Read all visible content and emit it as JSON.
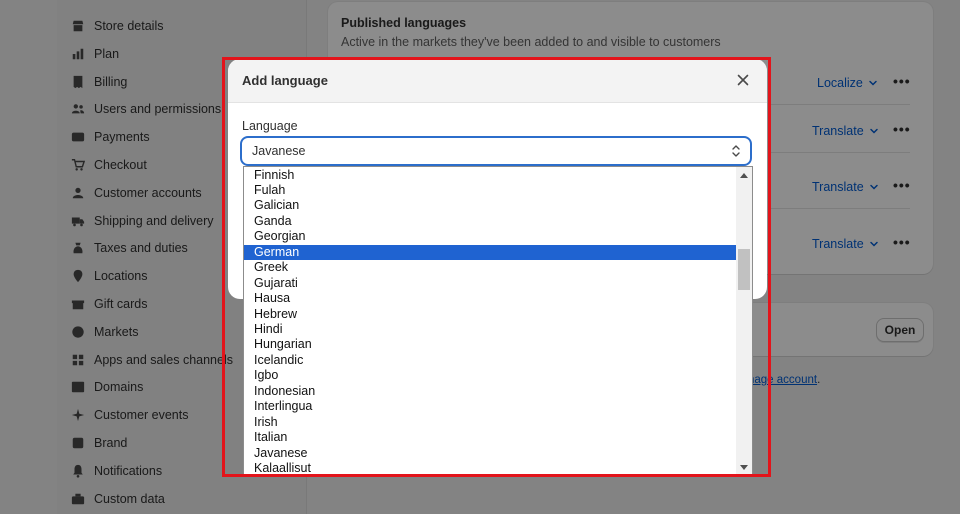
{
  "sidebar": {
    "items": [
      {
        "label": "Store details",
        "icon": "store-icon"
      },
      {
        "label": "Plan",
        "icon": "plan-icon"
      },
      {
        "label": "Billing",
        "icon": "billing-icon"
      },
      {
        "label": "Users and permissions",
        "icon": "users-icon"
      },
      {
        "label": "Payments",
        "icon": "payments-icon"
      },
      {
        "label": "Checkout",
        "icon": "cart-icon"
      },
      {
        "label": "Customer accounts",
        "icon": "person-icon"
      },
      {
        "label": "Shipping and delivery",
        "icon": "truck-icon"
      },
      {
        "label": "Taxes and duties",
        "icon": "tax-icon"
      },
      {
        "label": "Locations",
        "icon": "location-icon"
      },
      {
        "label": "Gift cards",
        "icon": "gift-icon"
      },
      {
        "label": "Markets",
        "icon": "globe-icon"
      },
      {
        "label": "Apps and sales channels",
        "icon": "apps-icon"
      },
      {
        "label": "Domains",
        "icon": "domain-icon"
      },
      {
        "label": "Customer events",
        "icon": "events-icon"
      },
      {
        "label": "Brand",
        "icon": "brand-icon"
      },
      {
        "label": "Notifications",
        "icon": "bell-icon"
      },
      {
        "label": "Custom data",
        "icon": "data-icon"
      }
    ]
  },
  "published": {
    "title": "Published languages",
    "subtitle": "Active in the markets they've been added to and visible to customers",
    "rows": [
      {
        "action": "Localize"
      },
      {
        "action": "Translate"
      },
      {
        "action": "Translate"
      },
      {
        "action": "Translate"
      }
    ]
  },
  "open_card": {
    "button": "Open"
  },
  "manage_link": {
    "text": "nage account",
    "suffix": "."
  },
  "modal": {
    "title": "Add language",
    "field_label": "Language",
    "selected_value": "Javanese"
  },
  "dropdown": {
    "options": [
      "Finnish",
      "Fulah",
      "Galician",
      "Ganda",
      "Georgian",
      "German",
      "Greek",
      "Gujarati",
      "Hausa",
      "Hebrew",
      "Hindi",
      "Hungarian",
      "Icelandic",
      "Igbo",
      "Indonesian",
      "Interlingua",
      "Irish",
      "Italian",
      "Javanese",
      "Kalaallisut"
    ],
    "highlighted": "German"
  },
  "colors": {
    "accent": "#005bd3",
    "selection": "#1f63d1",
    "highlight_border": "#e3141b"
  }
}
